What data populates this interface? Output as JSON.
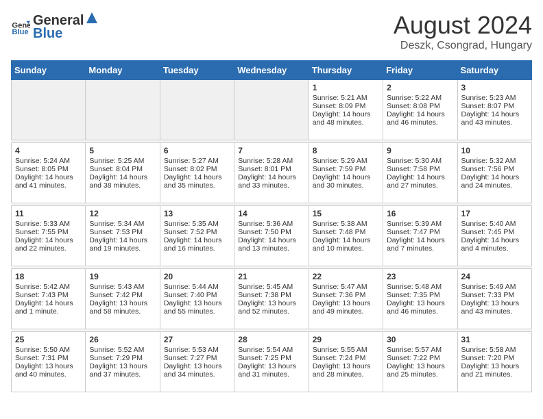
{
  "header": {
    "logo_general": "General",
    "logo_blue": "Blue",
    "month_year": "August 2024",
    "location": "Deszk, Csongrad, Hungary"
  },
  "days_of_week": [
    "Sunday",
    "Monday",
    "Tuesday",
    "Wednesday",
    "Thursday",
    "Friday",
    "Saturday"
  ],
  "weeks": [
    [
      {
        "day": "",
        "empty": true
      },
      {
        "day": "",
        "empty": true
      },
      {
        "day": "",
        "empty": true
      },
      {
        "day": "",
        "empty": true
      },
      {
        "day": "1",
        "sunrise": "Sunrise: 5:21 AM",
        "sunset": "Sunset: 8:09 PM",
        "daylight": "Daylight: 14 hours and 48 minutes."
      },
      {
        "day": "2",
        "sunrise": "Sunrise: 5:22 AM",
        "sunset": "Sunset: 8:08 PM",
        "daylight": "Daylight: 14 hours and 46 minutes."
      },
      {
        "day": "3",
        "sunrise": "Sunrise: 5:23 AM",
        "sunset": "Sunset: 8:07 PM",
        "daylight": "Daylight: 14 hours and 43 minutes."
      }
    ],
    [
      {
        "day": "4",
        "sunrise": "Sunrise: 5:24 AM",
        "sunset": "Sunset: 8:05 PM",
        "daylight": "Daylight: 14 hours and 41 minutes."
      },
      {
        "day": "5",
        "sunrise": "Sunrise: 5:25 AM",
        "sunset": "Sunset: 8:04 PM",
        "daylight": "Daylight: 14 hours and 38 minutes."
      },
      {
        "day": "6",
        "sunrise": "Sunrise: 5:27 AM",
        "sunset": "Sunset: 8:02 PM",
        "daylight": "Daylight: 14 hours and 35 minutes."
      },
      {
        "day": "7",
        "sunrise": "Sunrise: 5:28 AM",
        "sunset": "Sunset: 8:01 PM",
        "daylight": "Daylight: 14 hours and 33 minutes."
      },
      {
        "day": "8",
        "sunrise": "Sunrise: 5:29 AM",
        "sunset": "Sunset: 7:59 PM",
        "daylight": "Daylight: 14 hours and 30 minutes."
      },
      {
        "day": "9",
        "sunrise": "Sunrise: 5:30 AM",
        "sunset": "Sunset: 7:58 PM",
        "daylight": "Daylight: 14 hours and 27 minutes."
      },
      {
        "day": "10",
        "sunrise": "Sunrise: 5:32 AM",
        "sunset": "Sunset: 7:56 PM",
        "daylight": "Daylight: 14 hours and 24 minutes."
      }
    ],
    [
      {
        "day": "11",
        "sunrise": "Sunrise: 5:33 AM",
        "sunset": "Sunset: 7:55 PM",
        "daylight": "Daylight: 14 hours and 22 minutes."
      },
      {
        "day": "12",
        "sunrise": "Sunrise: 5:34 AM",
        "sunset": "Sunset: 7:53 PM",
        "daylight": "Daylight: 14 hours and 19 minutes."
      },
      {
        "day": "13",
        "sunrise": "Sunrise: 5:35 AM",
        "sunset": "Sunset: 7:52 PM",
        "daylight": "Daylight: 14 hours and 16 minutes."
      },
      {
        "day": "14",
        "sunrise": "Sunrise: 5:36 AM",
        "sunset": "Sunset: 7:50 PM",
        "daylight": "Daylight: 14 hours and 13 minutes."
      },
      {
        "day": "15",
        "sunrise": "Sunrise: 5:38 AM",
        "sunset": "Sunset: 7:48 PM",
        "daylight": "Daylight: 14 hours and 10 minutes."
      },
      {
        "day": "16",
        "sunrise": "Sunrise: 5:39 AM",
        "sunset": "Sunset: 7:47 PM",
        "daylight": "Daylight: 14 hours and 7 minutes."
      },
      {
        "day": "17",
        "sunrise": "Sunrise: 5:40 AM",
        "sunset": "Sunset: 7:45 PM",
        "daylight": "Daylight: 14 hours and 4 minutes."
      }
    ],
    [
      {
        "day": "18",
        "sunrise": "Sunrise: 5:42 AM",
        "sunset": "Sunset: 7:43 PM",
        "daylight": "Daylight: 14 hours and 1 minute."
      },
      {
        "day": "19",
        "sunrise": "Sunrise: 5:43 AM",
        "sunset": "Sunset: 7:42 PM",
        "daylight": "Daylight: 13 hours and 58 minutes."
      },
      {
        "day": "20",
        "sunrise": "Sunrise: 5:44 AM",
        "sunset": "Sunset: 7:40 PM",
        "daylight": "Daylight: 13 hours and 55 minutes."
      },
      {
        "day": "21",
        "sunrise": "Sunrise: 5:45 AM",
        "sunset": "Sunset: 7:38 PM",
        "daylight": "Daylight: 13 hours and 52 minutes."
      },
      {
        "day": "22",
        "sunrise": "Sunrise: 5:47 AM",
        "sunset": "Sunset: 7:36 PM",
        "daylight": "Daylight: 13 hours and 49 minutes."
      },
      {
        "day": "23",
        "sunrise": "Sunrise: 5:48 AM",
        "sunset": "Sunset: 7:35 PM",
        "daylight": "Daylight: 13 hours and 46 minutes."
      },
      {
        "day": "24",
        "sunrise": "Sunrise: 5:49 AM",
        "sunset": "Sunset: 7:33 PM",
        "daylight": "Daylight: 13 hours and 43 minutes."
      }
    ],
    [
      {
        "day": "25",
        "sunrise": "Sunrise: 5:50 AM",
        "sunset": "Sunset: 7:31 PM",
        "daylight": "Daylight: 13 hours and 40 minutes."
      },
      {
        "day": "26",
        "sunrise": "Sunrise: 5:52 AM",
        "sunset": "Sunset: 7:29 PM",
        "daylight": "Daylight: 13 hours and 37 minutes."
      },
      {
        "day": "27",
        "sunrise": "Sunrise: 5:53 AM",
        "sunset": "Sunset: 7:27 PM",
        "daylight": "Daylight: 13 hours and 34 minutes."
      },
      {
        "day": "28",
        "sunrise": "Sunrise: 5:54 AM",
        "sunset": "Sunset: 7:25 PM",
        "daylight": "Daylight: 13 hours and 31 minutes."
      },
      {
        "day": "29",
        "sunrise": "Sunrise: 5:55 AM",
        "sunset": "Sunset: 7:24 PM",
        "daylight": "Daylight: 13 hours and 28 minutes."
      },
      {
        "day": "30",
        "sunrise": "Sunrise: 5:57 AM",
        "sunset": "Sunset: 7:22 PM",
        "daylight": "Daylight: 13 hours and 25 minutes."
      },
      {
        "day": "31",
        "sunrise": "Sunrise: 5:58 AM",
        "sunset": "Sunset: 7:20 PM",
        "daylight": "Daylight: 13 hours and 21 minutes."
      }
    ]
  ]
}
